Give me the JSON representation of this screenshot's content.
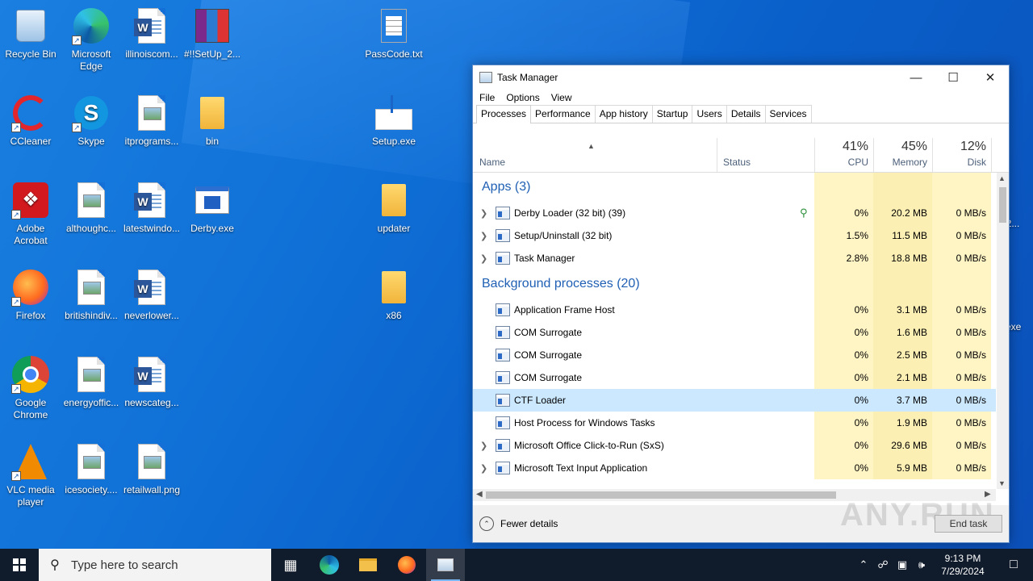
{
  "desktop": {
    "icons": [
      {
        "label": "Recycle Bin",
        "kind": "recycle"
      },
      {
        "label": "Microsoft Edge",
        "kind": "edge"
      },
      {
        "label": "illinoiscom...",
        "kind": "word"
      },
      {
        "label": "#!!SetUp_2...",
        "kind": "rar"
      },
      {
        "label": "PassCode.txt",
        "kind": "txt"
      },
      {
        "label": "CCleaner",
        "kind": "ccleaner"
      },
      {
        "label": "Skype",
        "kind": "skype"
      },
      {
        "label": "itprograms...",
        "kind": "image"
      },
      {
        "label": "bin",
        "kind": "folder"
      },
      {
        "label": "Setup.exe",
        "kind": "setup"
      },
      {
        "label": "Adobe Acrobat",
        "kind": "acrobat"
      },
      {
        "label": "althoughc...",
        "kind": "image"
      },
      {
        "label": "latestwindo...",
        "kind": "word"
      },
      {
        "label": "Derby.exe",
        "kind": "exe"
      },
      {
        "label": "updater",
        "kind": "folder"
      },
      {
        "label": "Firefox",
        "kind": "firefox"
      },
      {
        "label": "britishindiv...",
        "kind": "image"
      },
      {
        "label": "neverlower...",
        "kind": "word"
      },
      {
        "label": "x86",
        "kind": "folder"
      },
      {
        "label": "Google Chrome",
        "kind": "chrome"
      },
      {
        "label": "energyoffic...",
        "kind": "image"
      },
      {
        "label": "newscateg...",
        "kind": "word"
      },
      {
        "label": "VLC media player",
        "kind": "vlc"
      },
      {
        "label": "icesociety....",
        "kind": "image"
      },
      {
        "label": "retailwall.png",
        "kind": "image"
      }
    ],
    "partial_labels": [
      "_2...",
      "exe"
    ]
  },
  "task_manager": {
    "title": "Task Manager",
    "menu": [
      "File",
      "Options",
      "View"
    ],
    "tabs": [
      "Processes",
      "Performance",
      "App history",
      "Startup",
      "Users",
      "Details",
      "Services"
    ],
    "active_tab": "Processes",
    "columns": {
      "name": "Name",
      "status": "Status",
      "cpu": {
        "pct": "41%",
        "label": "CPU"
      },
      "memory": {
        "pct": "45%",
        "label": "Memory"
      },
      "disk": {
        "pct": "12%",
        "label": "Disk"
      }
    },
    "groups": {
      "apps": "Apps (3)",
      "background": "Background processes (20)"
    },
    "apps": [
      {
        "name": "Derby Loader (32 bit) (39)",
        "cpu": "0%",
        "memory": "20.2 MB",
        "disk": "0 MB/s",
        "expandable": true,
        "leaf": true
      },
      {
        "name": "Setup/Uninstall (32 bit)",
        "cpu": "1.5%",
        "memory": "11.5 MB",
        "disk": "0 MB/s",
        "expandable": true
      },
      {
        "name": "Task Manager",
        "cpu": "2.8%",
        "memory": "18.8 MB",
        "disk": "0 MB/s",
        "expandable": true
      }
    ],
    "background": [
      {
        "name": "Application Frame Host",
        "cpu": "0%",
        "memory": "3.1 MB",
        "disk": "0 MB/s"
      },
      {
        "name": "COM Surrogate",
        "cpu": "0%",
        "memory": "1.6 MB",
        "disk": "0 MB/s"
      },
      {
        "name": "COM Surrogate",
        "cpu": "0%",
        "memory": "2.5 MB",
        "disk": "0 MB/s"
      },
      {
        "name": "COM Surrogate",
        "cpu": "0%",
        "memory": "2.1 MB",
        "disk": "0 MB/s"
      },
      {
        "name": "CTF Loader",
        "cpu": "0%",
        "memory": "3.7 MB",
        "disk": "0 MB/s",
        "selected": true
      },
      {
        "name": "Host Process for Windows Tasks",
        "cpu": "0%",
        "memory": "1.9 MB",
        "disk": "0 MB/s"
      },
      {
        "name": "Microsoft Office Click-to-Run (SxS)",
        "cpu": "0%",
        "memory": "29.6 MB",
        "disk": "0 MB/s",
        "expandable": true
      },
      {
        "name": "Microsoft Text Input Application",
        "cpu": "0%",
        "memory": "5.9 MB",
        "disk": "0 MB/s",
        "expandable": true
      }
    ],
    "footer": {
      "fewer_details": "Fewer details",
      "end_task": "End task"
    },
    "watermark": "ANY.RUN"
  },
  "taskbar": {
    "search_placeholder": "Type here to search",
    "time": "9:13 PM",
    "date": "7/29/2024"
  }
}
